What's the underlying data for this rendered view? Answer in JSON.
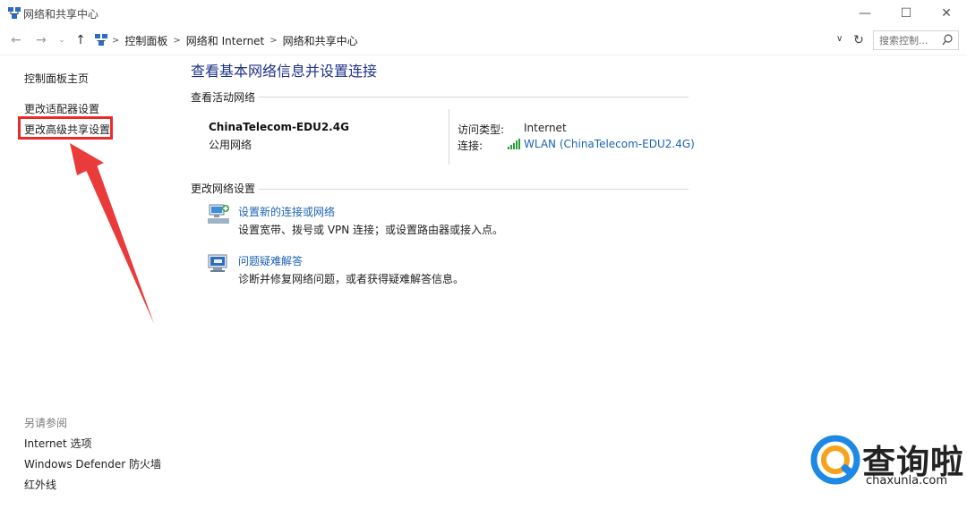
{
  "window": {
    "title": "网络和共享中心",
    "minimize": "—",
    "maximize": "☐",
    "close": "✕"
  },
  "address": {
    "back": "←",
    "forward": "→",
    "history": "⌄",
    "up": "↑",
    "breadcrumbs": [
      "控制面板",
      "网络和 Internet",
      "网络和共享中心"
    ],
    "separator": ">",
    "dropdown": "∨",
    "refresh": "↻",
    "search_placeholder": "搜索控制..."
  },
  "sidebar": {
    "home": "控制面板主页",
    "adapter": "更改适配器设置",
    "advanced": "更改高级共享设置",
    "see_also": "另请参阅",
    "internet_options": "Internet 选项",
    "defender": "Windows Defender 防火墙",
    "infrared": "红外线"
  },
  "main": {
    "heading": "查看基本网络信息并设置连接",
    "active_section": "查看活动网络",
    "network_name": "ChinaTelecom-EDU2.4G",
    "network_type": "公用网络",
    "access_label": "访问类型:",
    "access_value": "Internet",
    "connection_label": "连接:",
    "connection_value": "WLAN (ChinaTelecom-EDU2.4G)",
    "change_section": "更改网络设置",
    "task1_link": "设置新的连接或网络",
    "task1_desc": "设置宽带、拨号或 VPN 连接；或设置路由器或接入点。",
    "task2_link": "问题疑难解答",
    "task2_desc": "诊断并修复网络问题，或者获得疑难解答信息。"
  },
  "watermark": {
    "brand": "查询啦",
    "url": "chaxunla.com"
  },
  "colors": {
    "highlight": "#ea2b2b",
    "link": "#1b62b5",
    "heading": "#1e3287",
    "watermark_blue": "#1e88e5",
    "watermark_orange": "#f7a21b"
  }
}
